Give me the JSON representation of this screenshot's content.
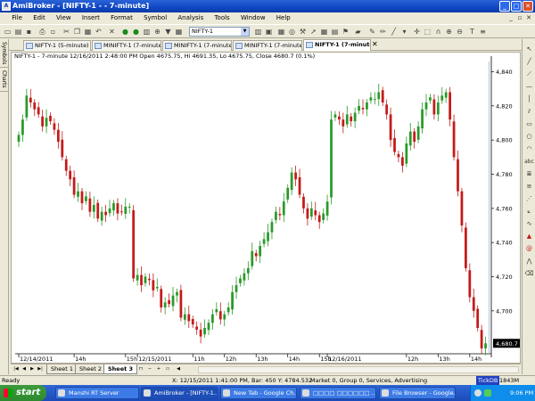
{
  "window": {
    "title": "AmiBroker - [NIFTY-1 -  - 7-minute]"
  },
  "menu": [
    "File",
    "Edit",
    "View",
    "Insert",
    "Format",
    "Symbol",
    "Analysis",
    "Tools",
    "Window",
    "Help"
  ],
  "toolbar": {
    "symbol_value": "NIFTY-1"
  },
  "side_tabs": [
    "Symbols",
    "Charts"
  ],
  "tabs": [
    "NIFTY-1 (5-minute)",
    "MINIFTY-1 (7-minute)",
    "MINIFTY-1 (7-minute)",
    "MINIFTY-1 (7-minute)",
    "NIFTY-1 (7-minute)"
  ],
  "chart_info": "NIFTY-1 - 7-minute 12/16/2011 2:48:00 PM Open 4675.75, Hi 4691.35, Lo 4675.75, Close 4680.7 (0.1%)",
  "sheets": [
    "Sheet 1",
    "Sheet 2",
    "Sheet 3"
  ],
  "status": {
    "ready": "Ready",
    "cursor": "X: 12/15/2011 1:41:00 PM, Bar: 450 Y: 4784.532",
    "market": "Market 0, Group 0, Services, Advertising",
    "tickdb": "TickDB",
    "memory": "1843M"
  },
  "taskbar": {
    "start": "start",
    "tasks": [
      "Manshi RT Server",
      "AmiBroker - [NIFTY-1...",
      "New Tab - Google Ch...",
      "□□□□ □□□□□□ ...",
      "File Browser - Google..."
    ],
    "clock": "9:06 PM"
  },
  "colors": {
    "bull": "#2a9a2a",
    "bear": "#c41a1a",
    "price_tag": "#000000"
  },
  "chart_data": {
    "type": "candlestick",
    "title": "NIFTY-1 - 7-minute",
    "y_ticks": [
      4700,
      4720,
      4740,
      4760,
      4780,
      4800,
      4820,
      4840
    ],
    "y_tick_labels": [
      "4,700",
      "4,720",
      "4,740",
      "4,760",
      "4,780",
      "4,800",
      "4,820",
      "4,840"
    ],
    "ylim": [
      4678,
      4846
    ],
    "x_labels": [
      {
        "bar": 0,
        "label": "12/14/2011"
      },
      {
        "bar": 14,
        "label": "14h"
      },
      {
        "bar": 27,
        "label": "15h"
      },
      {
        "bar": 30,
        "label": "12/15/2011"
      },
      {
        "bar": 44,
        "label": "11h"
      },
      {
        "bar": 52,
        "label": "12h"
      },
      {
        "bar": 60,
        "label": "13h"
      },
      {
        "bar": 68,
        "label": "14h"
      },
      {
        "bar": 76,
        "label": "15h"
      },
      {
        "bar": 78,
        "label": "12/16/2011"
      },
      {
        "bar": 98,
        "label": "12h"
      },
      {
        "bar": 106,
        "label": "13h"
      },
      {
        "bar": 114,
        "label": "14h"
      }
    ],
    "last_price": "4,680.7",
    "closes": [
      4803,
      4812,
      4826,
      4822,
      4818,
      4815,
      4808,
      4813,
      4811,
      4806,
      4799,
      4790,
      4782,
      4777,
      4768,
      4770,
      4763,
      4767,
      4758,
      4762,
      4754,
      4758,
      4756,
      4760,
      4763,
      4757,
      4758,
      4761,
      4761,
      4719,
      4721,
      4715,
      4720,
      4718,
      4712,
      4714,
      4702,
      4705,
      4704,
      4709,
      4711,
      4696,
      4698,
      4694,
      4692,
      4689,
      4685,
      4690,
      4693,
      4698,
      4701,
      4695,
      4698,
      4702,
      4711,
      4715,
      4719,
      4722,
      4725,
      4735,
      4732,
      4738,
      4742,
      4746,
      4752,
      4758,
      4756,
      4764,
      4772,
      4781,
      4777,
      4768,
      4760,
      4754,
      4760,
      4756,
      4752,
      4757,
      4764,
      4812,
      4815,
      4812,
      4808,
      4815,
      4811,
      4816,
      4820,
      4818,
      4822,
      4825,
      4824,
      4828,
      4822,
      4815,
      4800,
      4793,
      4790,
      4785,
      4798,
      4805,
      4799,
      4808,
      4818,
      4822,
      4825,
      4815,
      4822,
      4826,
      4828,
      4812,
      4790,
      4770,
      4750,
      4725,
      4708,
      4700,
      4690,
      4678,
      4681
    ],
    "volume": "hidden"
  }
}
